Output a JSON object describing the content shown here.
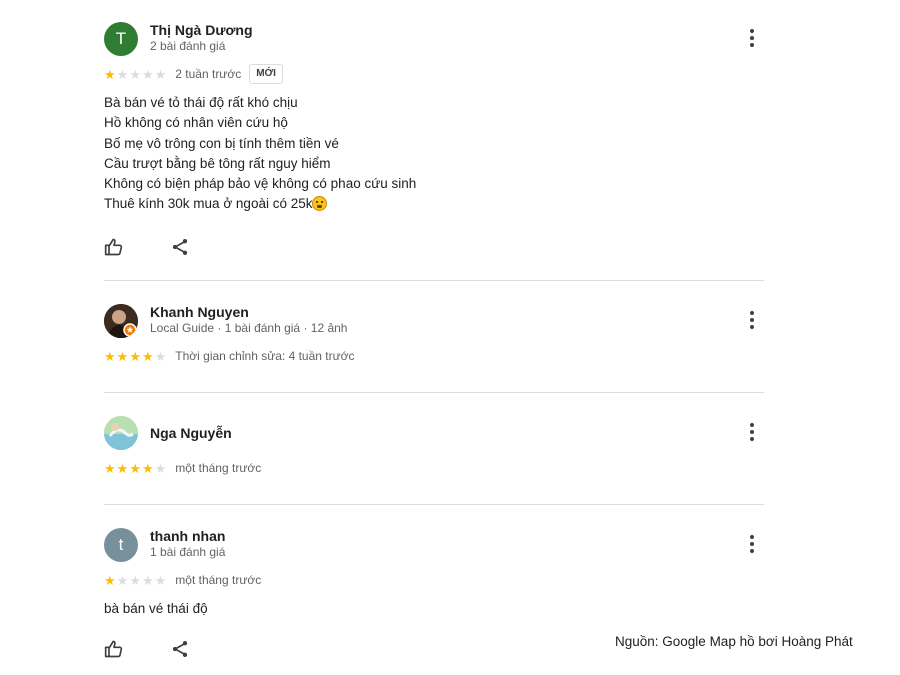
{
  "reviews": [
    {
      "name": "Thị Ngà Dương",
      "meta": "2 bài đánh giá",
      "avatar_letter": "T",
      "avatar_color": "#2e7d32",
      "rating": 1,
      "time": "2 tuần trước",
      "badge": "MỚI",
      "lines": [
        "Bà bán vé tỏ thái độ rất khó chịu",
        "Hồ không có nhân viên cứu hộ",
        "Bố mẹ vô trông con bị tính thêm tiền vé",
        "Cầu trượt bằng bê tông rất nguy hiểm",
        "Không có biện pháp bảo vệ không có phao cứu sinh",
        "Thuê kính 30k mua ở ngoài có 25k"
      ],
      "emoji": "face-with-steam-icon"
    },
    {
      "name": "Khanh Nguyen",
      "meta": "Local Guide · 1 bài đánh giá · 12 ảnh",
      "rating": 4,
      "time": "Thời gian chỉnh sửa: 4 tuần trước"
    },
    {
      "name": "Nga Nguyễn",
      "rating": 4,
      "time": "một tháng trước"
    },
    {
      "name": "thanh nhan",
      "meta": "1 bài đánh giá",
      "avatar_letter": "t",
      "avatar_color": "#78909c",
      "rating": 1,
      "time": "một tháng trước",
      "lines": [
        "bà bán vé thái độ"
      ]
    }
  ],
  "icons": {
    "like": "thumb-up-icon",
    "share": "share-icon",
    "menu": "more-vert-icon",
    "star": "star-icon"
  },
  "colors": {
    "star_on": "#fbbc04",
    "star_off": "#dadce0"
  },
  "source": "Nguồn: Google Map hồ bơi Hoàng Phát"
}
